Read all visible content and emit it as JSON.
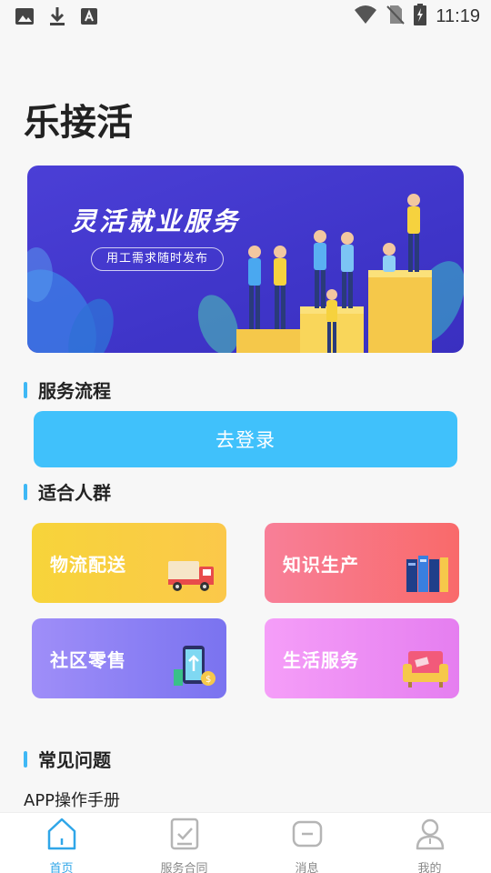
{
  "status_bar": {
    "time": "11:19",
    "icons": [
      "image-icon",
      "download-icon",
      "font-icon",
      "wifi-icon",
      "no-sim-icon",
      "battery-charging-icon"
    ]
  },
  "app": {
    "title": "乐接活"
  },
  "banner": {
    "title": "灵活就业服务",
    "subtitle": "用工需求随时发布",
    "background": "#4b3fd6"
  },
  "sections": {
    "process": {
      "title": "服务流程"
    },
    "audience": {
      "title": "适合人群"
    },
    "faq": {
      "title": "常见问题"
    }
  },
  "login_button": {
    "label": "去登录",
    "color": "#40c1fb"
  },
  "audience_cards": [
    {
      "label": "物流配送",
      "icon": "delivery-truck-icon",
      "color": "#f7d43a"
    },
    {
      "label": "知识生产",
      "icon": "books-icon",
      "color": "#f87f98"
    },
    {
      "label": "社区零售",
      "icon": "phone-payment-icon",
      "color": "#8f82f4"
    },
    {
      "label": "生活服务",
      "icon": "sofa-icon",
      "color": "#f094f5"
    }
  ],
  "faq_items": [
    {
      "label": "APP操作手册"
    }
  ],
  "tabbar": {
    "active_color": "#2fa6e8",
    "tabs": [
      {
        "label": "首页",
        "icon": "home-icon",
        "active": true
      },
      {
        "label": "服务合同",
        "icon": "contract-icon",
        "active": false
      },
      {
        "label": "消息",
        "icon": "message-icon",
        "active": false
      },
      {
        "label": "我的",
        "icon": "profile-icon",
        "active": false
      }
    ]
  }
}
